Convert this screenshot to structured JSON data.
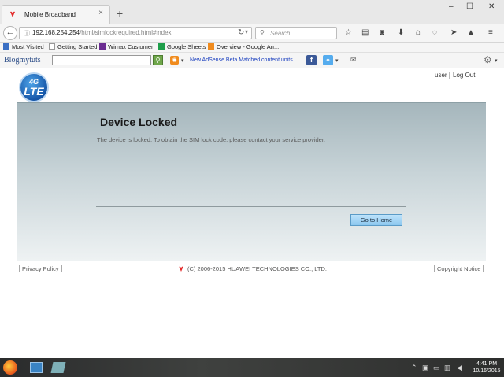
{
  "browser": {
    "tab_title": "Mobile Broadband",
    "tab_close": "×",
    "new_tab": "+",
    "window_controls": {
      "minimize": "–",
      "maximize": "☐",
      "close": "✕"
    },
    "url_host": "192.168.254.254",
    "url_path": "/html/simlockrequired.html#index",
    "search_placeholder": "Search",
    "bookmarks": [
      {
        "label": "Most Visited",
        "icon": "most-visited-icon",
        "color": "#3a6fc4"
      },
      {
        "label": "Getting Started",
        "icon": "page-icon",
        "color": "#ffffff"
      },
      {
        "label": "Wimax Customer",
        "icon": "wimax-icon",
        "color": "#6b2c91"
      },
      {
        "label": "Google Sheets",
        "icon": "sheets-icon",
        "color": "#1e9e4a"
      },
      {
        "label": "Overview - Google An...",
        "icon": "analytics-icon",
        "color": "#f08b1d"
      }
    ]
  },
  "blog_toolbar": {
    "logo": "Blogmytuts",
    "link": "New AdSense Beta Matched content units"
  },
  "page": {
    "logo_4g": "4G",
    "logo_lte": "LTE",
    "user_link": "user",
    "logout_link": "Log Out",
    "title": "Device Locked",
    "message": "The device is locked. To obtain the SIM lock code, please contact your service provider.",
    "home_button": "Go to Home",
    "footer": {
      "privacy": "Privacy Policy",
      "copyright_text": "(C) 2006-2015 HUAWEI TECHNOLOGIES CO., LTD.",
      "copyright_notice": "Copyright Notice"
    }
  },
  "taskbar": {
    "time": "4:41 PM",
    "date": "10/16/2015"
  },
  "colors": {
    "banner_top": "#a5b6bc",
    "button": "#8bc7ef",
    "huawei_red": "#e32b2b"
  }
}
